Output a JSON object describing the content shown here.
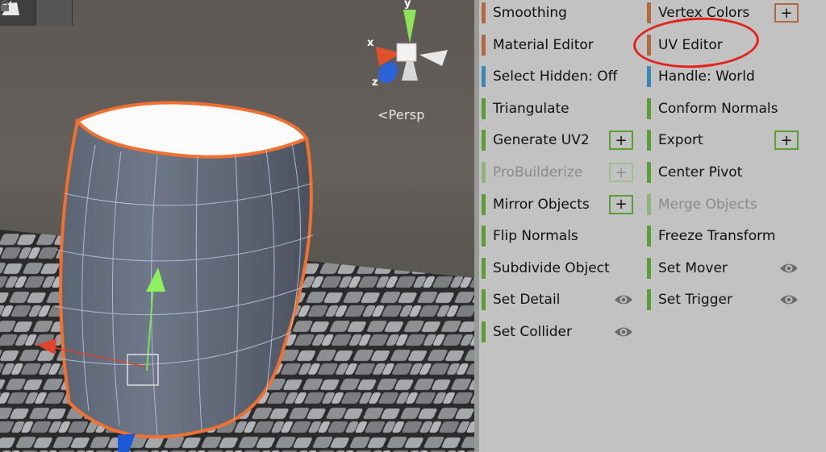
{
  "scene": {
    "view_label": "Persp",
    "axes": {
      "x": "x",
      "y": "y",
      "z": "z"
    }
  },
  "panel": {
    "left_column": [
      {
        "id": "smoothing",
        "label": "Smoothing",
        "stripe": "orange"
      },
      {
        "id": "material-editor",
        "label": "Material Editor",
        "stripe": "orange"
      },
      {
        "id": "select-hidden",
        "label": "Select Hidden: Off",
        "stripe": "blue"
      },
      {
        "id": "triangulate",
        "label": "Triangulate",
        "stripe": "green"
      },
      {
        "id": "generate-uv2",
        "label": "Generate UV2",
        "stripe": "green",
        "extra": "plus"
      },
      {
        "id": "probuilderize",
        "label": "ProBuilderize",
        "stripe": "green-dim",
        "extra": "plus",
        "disabled": true
      },
      {
        "id": "mirror-objects",
        "label": "Mirror Objects",
        "stripe": "green",
        "extra": "plus"
      },
      {
        "id": "flip-normals",
        "label": "Flip Normals",
        "stripe": "green"
      },
      {
        "id": "subdivide-object",
        "label": "Subdivide Object",
        "stripe": "green"
      },
      {
        "id": "set-detail",
        "label": "Set Detail",
        "stripe": "green",
        "extra": "eye"
      },
      {
        "id": "set-collider",
        "label": "Set Collider",
        "stripe": "green",
        "extra": "eye"
      }
    ],
    "right_column": [
      {
        "id": "vertex-colors",
        "label": "Vertex Colors",
        "stripe": "orange",
        "extra": "plus"
      },
      {
        "id": "uv-editor",
        "label": "UV Editor",
        "stripe": "orange",
        "highlighted": true
      },
      {
        "id": "handle-world",
        "label": "Handle: World",
        "stripe": "blue"
      },
      {
        "id": "conform-normals",
        "label": "Conform Normals",
        "stripe": "green"
      },
      {
        "id": "export",
        "label": "Export",
        "stripe": "green",
        "extra": "plus"
      },
      {
        "id": "center-pivot",
        "label": "Center Pivot",
        "stripe": "green"
      },
      {
        "id": "merge-objects",
        "label": "Merge Objects",
        "stripe": "green-dim",
        "disabled": true
      },
      {
        "id": "freeze-transform",
        "label": "Freeze Transform",
        "stripe": "green"
      },
      {
        "id": "set-mover",
        "label": "Set Mover",
        "stripe": "green",
        "extra": "eye"
      },
      {
        "id": "set-trigger",
        "label": "Set Trigger",
        "stripe": "green",
        "extra": "eye"
      }
    ],
    "plus_symbol": "+"
  },
  "colors": {
    "stripe_orange": "#b06a3f",
    "stripe_blue": "#3a89b5",
    "stripe_green": "#5a9e35",
    "highlight": "#e2231a",
    "selection_outline": "#f07030"
  }
}
